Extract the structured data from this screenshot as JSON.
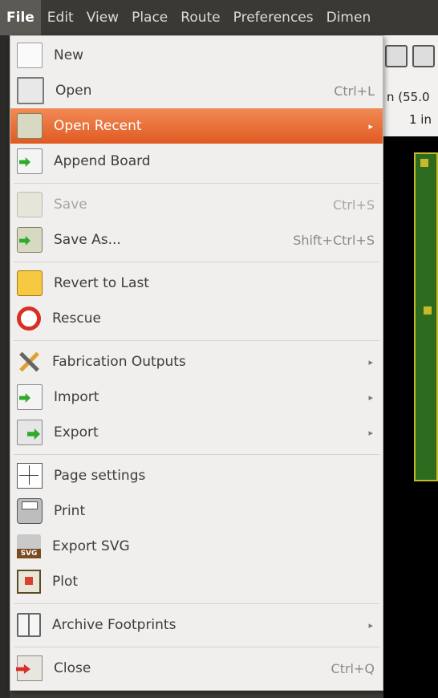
{
  "menubar": {
    "items": [
      "File",
      "Edit",
      "View",
      "Place",
      "Route",
      "Preferences",
      "Dimen"
    ]
  },
  "background": {
    "status_line1": "n (55.0",
    "status_line2": "1 in"
  },
  "menu": {
    "items": [
      {
        "label": "New",
        "accel": "",
        "icon": "new-document-icon"
      },
      {
        "label": "Open",
        "accel": "Ctrl+L",
        "icon": "open-icon"
      },
      {
        "label": "Open Recent",
        "accel": "",
        "icon": "open-recent-icon",
        "submenu": true,
        "highlighted": true
      },
      {
        "label": "Append Board",
        "accel": "",
        "icon": "append-board-icon"
      },
      {
        "label": "Save",
        "accel": "Ctrl+S",
        "icon": "save-icon",
        "disabled": true
      },
      {
        "label": "Save As...",
        "accel": "Shift+Ctrl+S",
        "icon": "save-as-icon"
      },
      {
        "label": "Revert to Last",
        "accel": "",
        "icon": "revert-icon"
      },
      {
        "label": "Rescue",
        "accel": "",
        "icon": "rescue-icon"
      },
      {
        "label": "Fabrication Outputs",
        "accel": "",
        "icon": "fabrication-outputs-icon",
        "submenu": true
      },
      {
        "label": "Import",
        "accel": "",
        "icon": "import-icon",
        "submenu": true
      },
      {
        "label": "Export",
        "accel": "",
        "icon": "export-icon",
        "submenu": true
      },
      {
        "label": "Page settings",
        "accel": "",
        "icon": "page-settings-icon"
      },
      {
        "label": "Print",
        "accel": "",
        "icon": "printer-icon"
      },
      {
        "label": "Export SVG",
        "accel": "",
        "icon": "export-svg-icon"
      },
      {
        "label": "Plot",
        "accel": "",
        "icon": "plot-icon"
      },
      {
        "label": "Archive Footprints",
        "accel": "",
        "icon": "archive-footprints-icon",
        "submenu": true
      },
      {
        "label": "Close",
        "accel": "Ctrl+Q",
        "icon": "close-icon"
      }
    ],
    "submenu_glyph": "▸"
  },
  "colors": {
    "highlight": "#e8652e",
    "menu_bg": "#f0efed",
    "menubar_bg": "#3a3935"
  }
}
